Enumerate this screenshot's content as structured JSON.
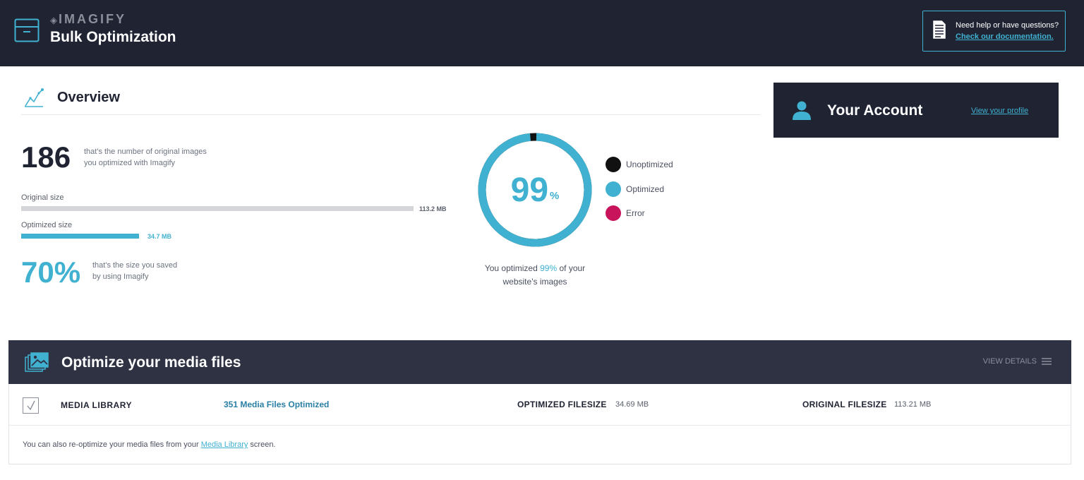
{
  "header": {
    "brand": "IMAGIFY",
    "title": "Bulk Optimization",
    "help_question": "Need help or have questions?",
    "help_link": "Check our documentation."
  },
  "overview": {
    "title": "Overview",
    "images_count": "186",
    "images_desc_line1": "that's the number of original images",
    "images_desc_line2": "you optimized with Imagify",
    "original_label": "Original size",
    "original_value": "113.2 MB",
    "optimized_label": "Optimized size",
    "optimized_value": "34.7 MB",
    "optimized_fill_fraction": 0.3,
    "saved_percent": "70%",
    "saved_desc_line1": "that's the size you saved",
    "saved_desc_line2": "by using Imagify",
    "donut_value": "99",
    "donut_unit": "%",
    "donut_fraction": 0.99,
    "legend": [
      {
        "label": "Unoptimized",
        "color": "#111111"
      },
      {
        "label": "Optimized",
        "color": "#40b1d0"
      },
      {
        "label": "Error",
        "color": "#c8145a"
      }
    ],
    "caption_before": "You optimized ",
    "caption_pct": "99%",
    "caption_after": " of your",
    "caption_line2": "website's images"
  },
  "account": {
    "title": "Your Account",
    "profile_link": "View your profile"
  },
  "media": {
    "title": "Optimize your media files",
    "view_details": "VIEW DETAILS",
    "library_label": "MEDIA LIBRARY",
    "files_optimized": "351 Media Files Optimized",
    "optimized_filesize_label": "OPTIMIZED FILESIZE",
    "optimized_filesize_value": "34.69 MB",
    "original_filesize_label": "ORIGINAL FILESIZE",
    "original_filesize_value": "113.21 MB",
    "note_before": "You can also re-optimize your media files from your ",
    "note_link": "Media Library",
    "note_after": " screen."
  },
  "colors": {
    "accent": "#40b1d0",
    "dark": "#1f2332",
    "error": "#c8145a"
  }
}
